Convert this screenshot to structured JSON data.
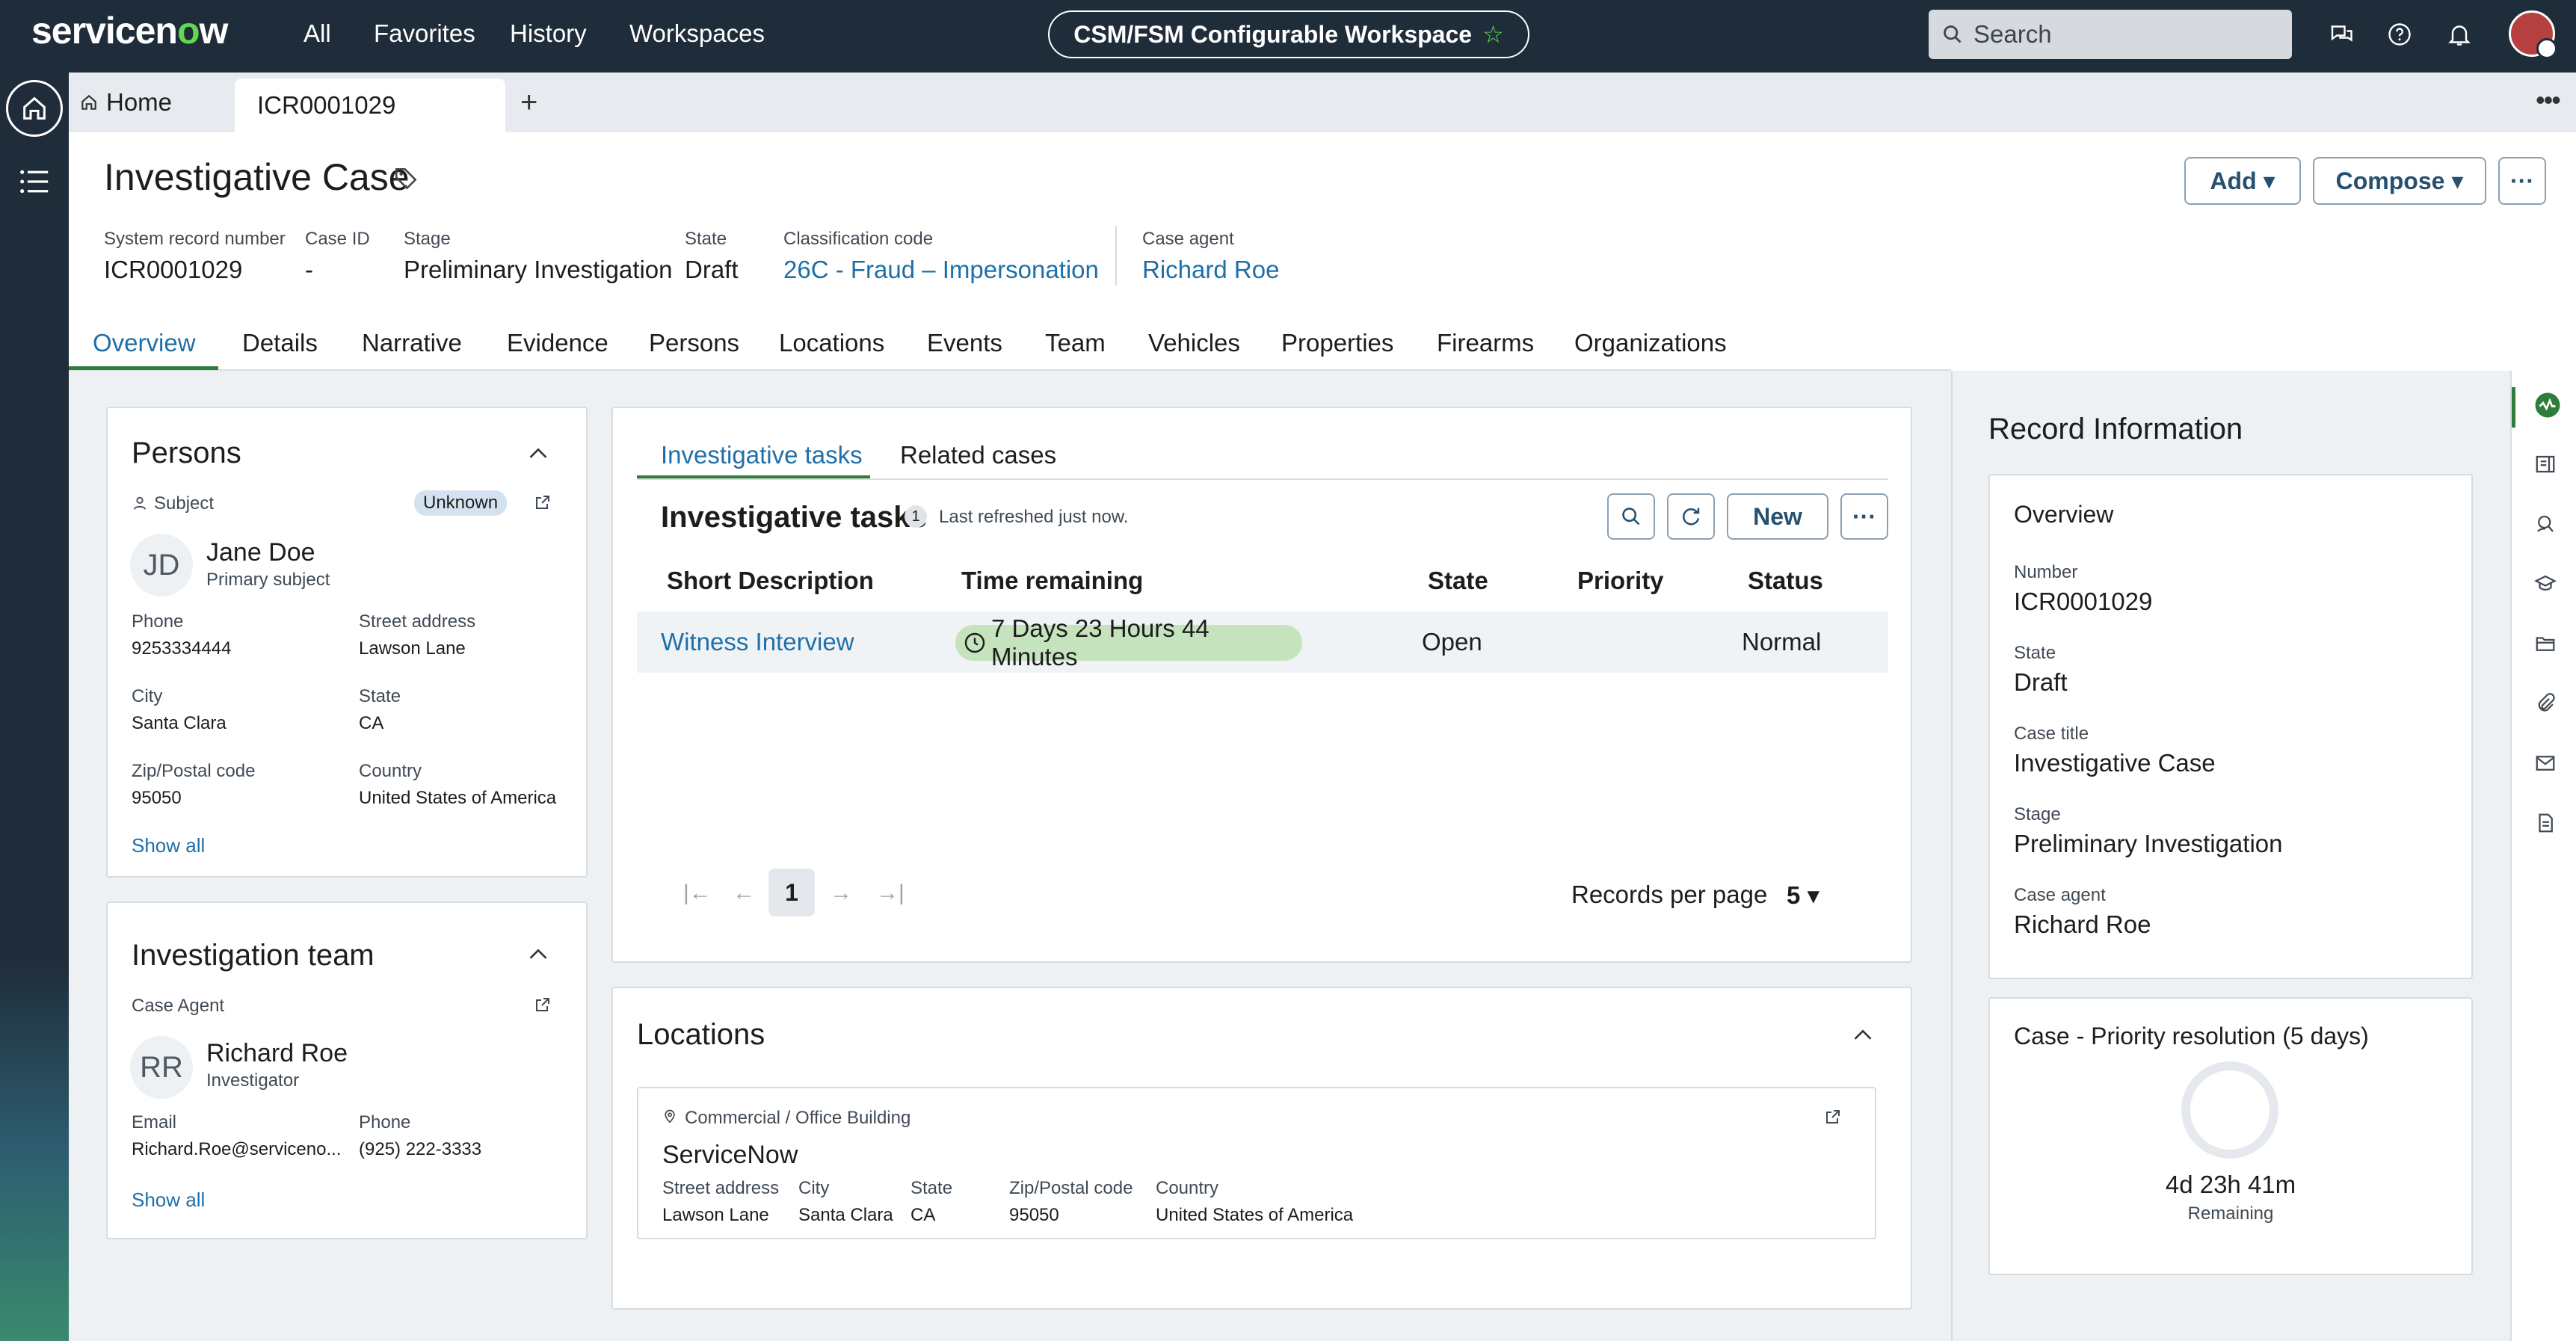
{
  "topbar": {
    "logo_pre": "servicen",
    "logo_o": "o",
    "logo_post": "w",
    "nav": [
      "All",
      "Favorites",
      "History",
      "Workspaces"
    ],
    "workspace": "CSM/FSM Configurable Workspace",
    "search_placeholder": "Search"
  },
  "tabs": {
    "home": "Home",
    "active": "ICR0001029"
  },
  "header": {
    "title": "Investigative Case",
    "add": "Add",
    "compose": "Compose",
    "fields": [
      {
        "label": "System record number",
        "value": "ICR0001029"
      },
      {
        "label": "Case ID",
        "value": "-"
      },
      {
        "label": "Stage",
        "value": "Preliminary Investigation"
      },
      {
        "label": "State",
        "value": "Draft"
      },
      {
        "label": "Classification code",
        "value": "26C - Fraud – Impersonation"
      },
      {
        "label": "Case agent",
        "value": "Richard Roe"
      }
    ]
  },
  "main_tabs": [
    "Overview",
    "Details",
    "Narrative",
    "Evidence",
    "Persons",
    "Locations",
    "Events",
    "Team",
    "Vehicles",
    "Properties",
    "Firearms",
    "Organizations"
  ],
  "persons": {
    "title": "Persons",
    "role": "Subject",
    "status": "Unknown",
    "initials": "JD",
    "name": "Jane Doe",
    "subtitle": "Primary subject",
    "fields": [
      {
        "label": "Phone",
        "value": "9253334444"
      },
      {
        "label": "Street address",
        "value": "Lawson Lane"
      },
      {
        "label": "City",
        "value": "Santa Clara"
      },
      {
        "label": "State",
        "value": "CA"
      },
      {
        "label": "Zip/Postal code",
        "value": "95050"
      },
      {
        "label": "Country",
        "value": "United States of America"
      }
    ],
    "show_all": "Show all"
  },
  "team": {
    "title": "Investigation team",
    "role": "Case Agent",
    "initials": "RR",
    "name": "Richard Roe",
    "subtitle": "Investigator",
    "email_label": "Email",
    "email": "Richard.Roe@serviceno...",
    "phone_label": "Phone",
    "phone": "(925) 222-3333",
    "show_all": "Show all"
  },
  "tasks": {
    "tabs": [
      "Investigative tasks",
      "Related cases"
    ],
    "heading": "Investigative tasks",
    "count": "1",
    "refreshed": "Last refreshed just now.",
    "new_button": "New",
    "columns": [
      "Short Description",
      "Time remaining",
      "State",
      "Priority",
      "Status"
    ],
    "rows": [
      {
        "desc": "Witness Interview",
        "time": "7 Days 23 Hours 44 Minutes",
        "state": "Open",
        "priority": "",
        "status": "Normal"
      }
    ],
    "page": "1",
    "per_page_label": "Records per page",
    "per_page": "5"
  },
  "locations": {
    "title": "Locations",
    "type": "Commercial / Office Building",
    "name": "ServiceNow",
    "fields": [
      {
        "label": "Street address",
        "value": "Lawson Lane"
      },
      {
        "label": "City",
        "value": "Santa Clara"
      },
      {
        "label": "State",
        "value": "CA"
      },
      {
        "label": "Zip/Postal code",
        "value": "95050"
      },
      {
        "label": "Country",
        "value": "United States of America"
      }
    ]
  },
  "record": {
    "title": "Record Information",
    "overview": "Overview",
    "fields": [
      {
        "label": "Number",
        "value": "ICR0001029"
      },
      {
        "label": "State",
        "value": "Draft"
      },
      {
        "label": "Case title",
        "value": "Investigative Case"
      },
      {
        "label": "Stage",
        "value": "Preliminary Investigation"
      },
      {
        "label": "Case agent",
        "value": "Richard Roe"
      }
    ],
    "sla_title": "Case - Priority resolution (5 days)",
    "sla_time": "4d 23h 41m",
    "sla_sub": "Remaining"
  },
  "colors": {
    "nav_bg": "#1f2d3a",
    "brand_green": "#62d84e",
    "link": "#1f6fa8",
    "accent": "#2e7d3a"
  }
}
